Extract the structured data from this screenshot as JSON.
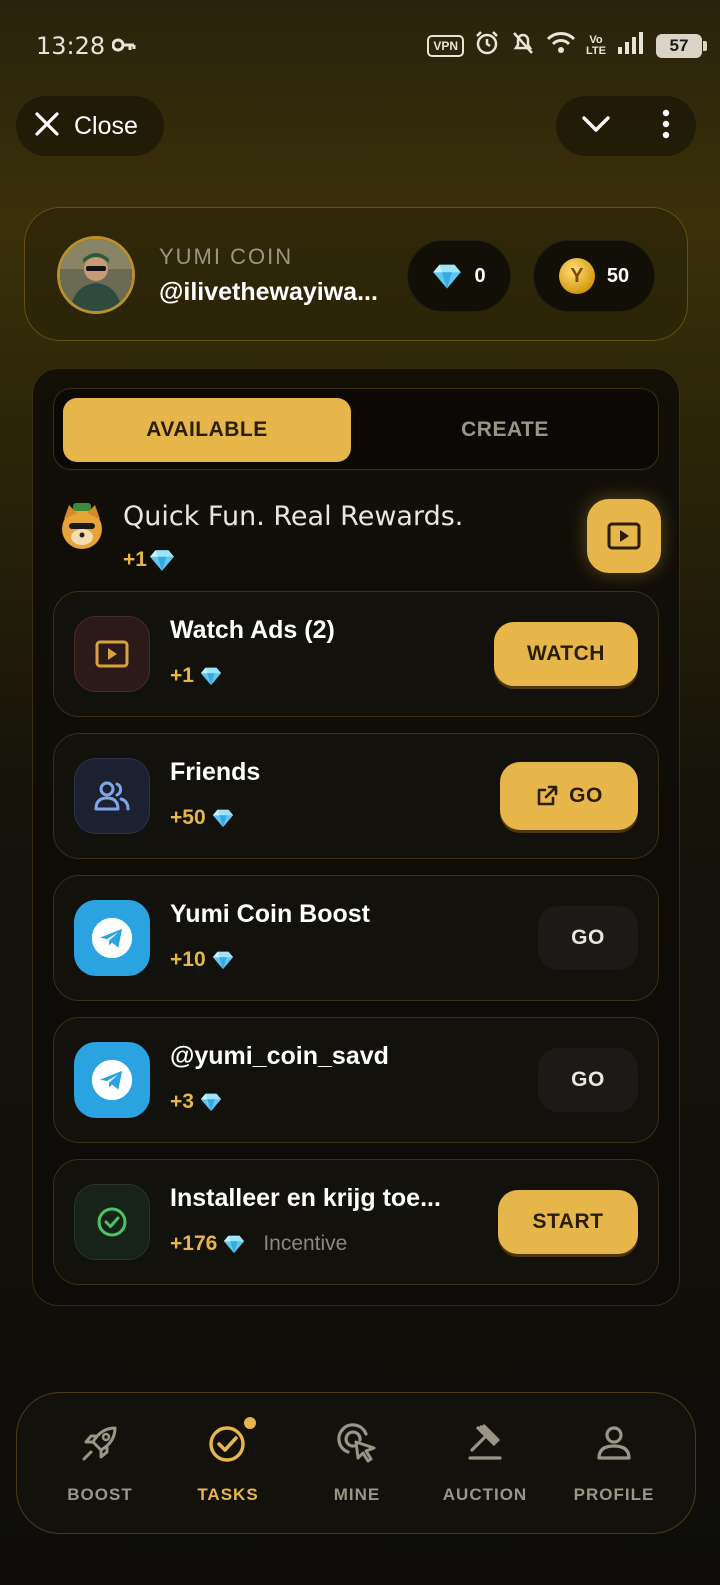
{
  "status_bar": {
    "time": "13:28",
    "vpn_label": "VPN",
    "volte_label_top": "Vo",
    "volte_label_bottom": "LTE",
    "battery": "57"
  },
  "top_bar": {
    "close_label": "Close"
  },
  "profile": {
    "app_name": "YUMI COIN",
    "username": "@ilivethewayiwa...",
    "gems": "0",
    "coins": "50",
    "coin_glyph": "Y"
  },
  "tabs": {
    "available": "AVAILABLE",
    "create": "CREATE"
  },
  "promo": {
    "title": "Quick Fun. Real Rewards.",
    "reward": "+1"
  },
  "tasks": [
    {
      "title": "Watch Ads (2)",
      "reward": "+1",
      "subtitle": "",
      "button": "WATCH",
      "icon": "play-icon"
    },
    {
      "title": "Friends",
      "reward": "+50",
      "subtitle": "",
      "button": "GO",
      "icon": "users-icon"
    },
    {
      "title": "Yumi Coin Boost",
      "reward": "+10",
      "subtitle": "",
      "button": "GO",
      "icon": "telegram-icon"
    },
    {
      "title": "@yumi_coin_savd",
      "reward": "+3",
      "subtitle": "",
      "button": "GO",
      "icon": "telegram-icon"
    },
    {
      "title": "Installeer en krijg toe...",
      "reward": "+176",
      "subtitle": "Incentive",
      "button": "START",
      "icon": "check-circle-icon"
    }
  ],
  "nav": {
    "boost": "BOOST",
    "tasks": "TASKS",
    "mine": "MINE",
    "auction": "AUCTION",
    "profile": "PROFILE"
  },
  "colors": {
    "accent": "#e7b64a",
    "telegram": "#2aa3e0",
    "background": "#15130a"
  }
}
